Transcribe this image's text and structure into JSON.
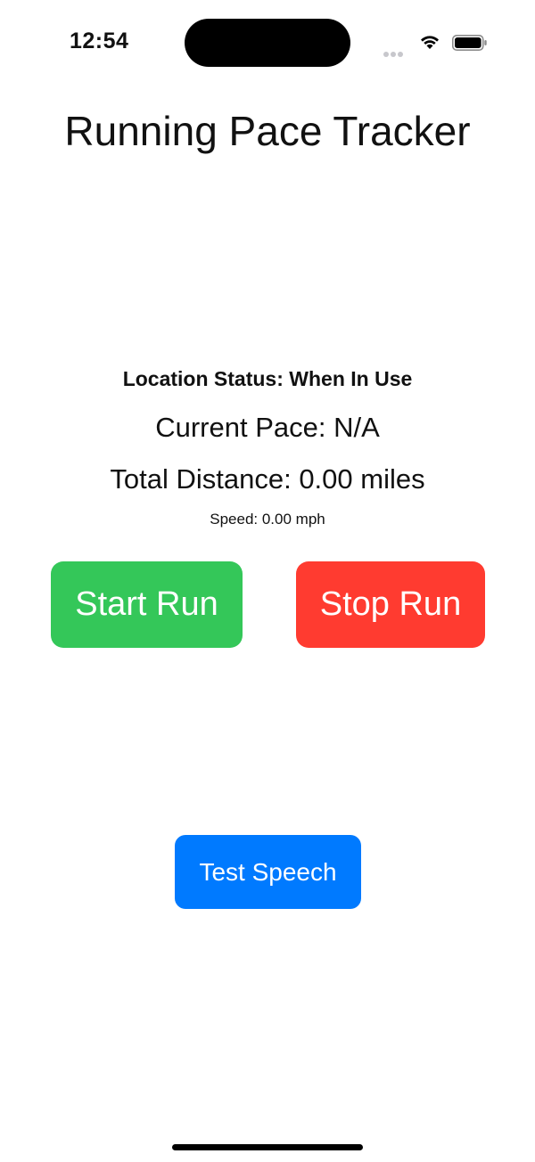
{
  "status_bar": {
    "time": "12:54",
    "icons": [
      "cellular-signal-icon",
      "wifi-icon",
      "battery-icon"
    ]
  },
  "app": {
    "title": "Running Pace Tracker",
    "location_status": "Location Status: When In Use",
    "current_pace": "Current Pace: N/A",
    "total_distance": "Total Distance: 0.00 miles",
    "speed": "Speed: 0.00 mph"
  },
  "buttons": {
    "start_label": "Start Run",
    "stop_label": "Stop Run",
    "test_speech_label": "Test Speech"
  },
  "colors": {
    "start": "#34C759",
    "stop": "#FF3B30",
    "test_speech": "#007AFF"
  }
}
